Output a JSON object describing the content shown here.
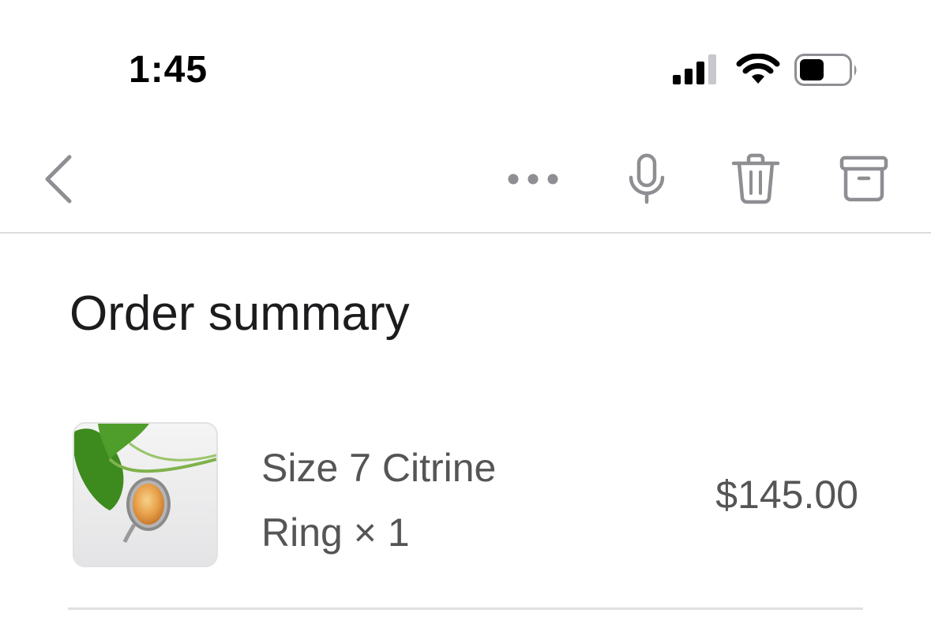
{
  "status_bar": {
    "time": "1:45"
  },
  "toolbar": {
    "back_icon": "chevron-left-icon",
    "more_icon": "ellipsis-icon",
    "mic_icon": "microphone-icon",
    "trash_icon": "trash-icon",
    "archive_icon": "archive-icon",
    "icon_color": "#8e8e93"
  },
  "order_summary": {
    "title": "Order summary",
    "items": [
      {
        "name_line1": "Size 7 Citrine",
        "name_line2": "Ring × 1",
        "price": "$145.00"
      }
    ]
  }
}
